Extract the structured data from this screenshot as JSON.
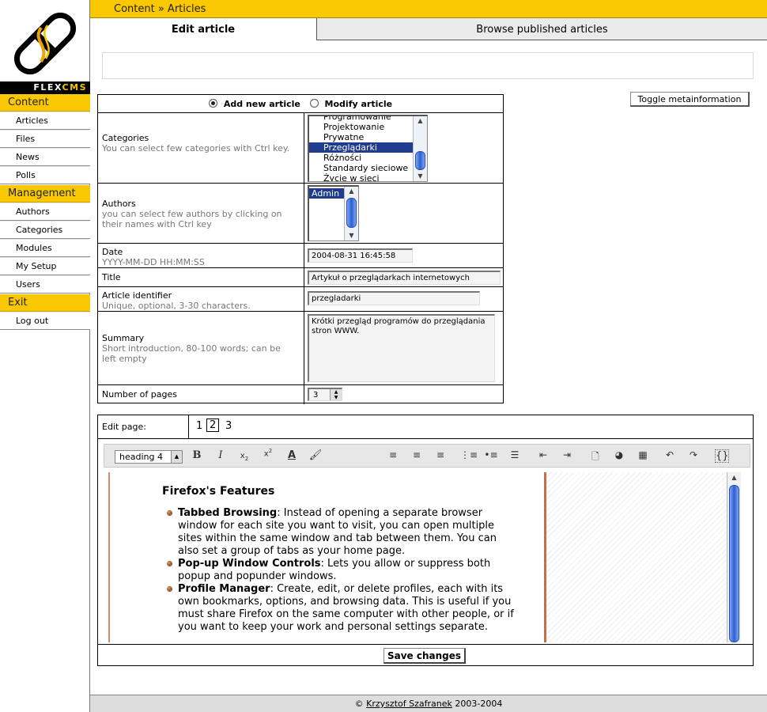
{
  "logo": {
    "text_part1": "FLEX",
    "text_part2": "CMS"
  },
  "sidebar": {
    "sections": [
      {
        "label": "Content",
        "items": [
          "Articles",
          "Files",
          "News",
          "Polls"
        ]
      },
      {
        "label": "Management",
        "items": [
          "Authors",
          "Categories",
          "Modules",
          "My Setup",
          "Users"
        ]
      },
      {
        "label": "Exit",
        "items": [
          "Log out"
        ]
      }
    ]
  },
  "breadcrumb": "Content » Articles",
  "tabs": {
    "edit": "Edit article",
    "browse": "Browse published articles"
  },
  "toggle_button": "Toggle metainformation",
  "form": {
    "mode_new": "Add new article",
    "mode_modify": "Modify article",
    "categories": {
      "label": "Categories",
      "help": "You can select few categories with Ctrl key.",
      "options": [
        "Programowanie",
        "Projektowanie",
        "Prywatne",
        "Przeglądarki",
        "Różności",
        "Standardy sieciowe",
        "Życie w sieci"
      ],
      "selected": "Przeglądarki"
    },
    "authors": {
      "label": "Authors",
      "help": "you can select few authors by clicking on their names with Ctrl key",
      "options": [
        "Admin"
      ],
      "selected": "Admin"
    },
    "date": {
      "label": "Date",
      "help": "YYYY-MM-DD HH:MM:SS",
      "value": "2004-08-31 16:45:58"
    },
    "title": {
      "label": "Title",
      "value": "Artykuł o przeglądarkach internetowych"
    },
    "identifier": {
      "label": "Article identifier",
      "help": "Unique, optional, 3-30 characters.",
      "value": "przegladarki"
    },
    "summary": {
      "label": "Summary",
      "help": "Short introduction, 80-100 words; can be left empty",
      "value": "Krótki przegląd programów do przeglądania stron WWW."
    },
    "pages": {
      "label": "Number of pages",
      "value": "3"
    }
  },
  "editor": {
    "edit_page_label": "Edit page:",
    "pages": [
      "1",
      "2",
      "3"
    ],
    "current_page": "2",
    "heading_select": "heading 4",
    "content": {
      "heading": "Firefox's Features",
      "items": [
        {
          "title": "Tabbed Browsing",
          "text": ": Instead of opening a separate browser window for each site you want to visit, you can open multiple sites within the same window and tab between them. You can also set a group of tabs as your home page."
        },
        {
          "title": "Pop-up Window Controls",
          "text": ": Lets you allow or suppress both popup and popunder windows."
        },
        {
          "title": "Profile Manager",
          "text": ": Create, edit, or delete profiles, each with its own bookmarks, options, and browsing data. This is useful if you must share Firefox on the same computer with other people, or if you want to keep your work and personal settings separate."
        }
      ]
    },
    "save_button": "Save changes"
  },
  "footer": {
    "copyright": "©",
    "author": "Krzysztof Szafranek",
    "years": "2003-2004"
  }
}
